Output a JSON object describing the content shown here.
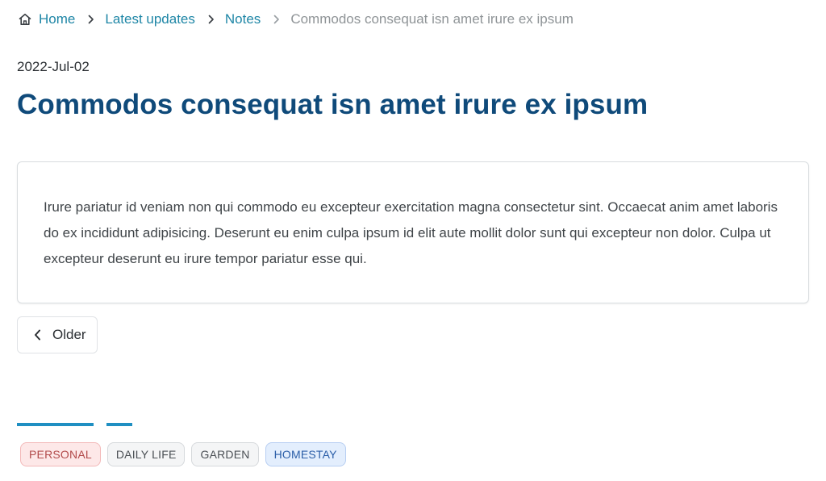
{
  "breadcrumb": {
    "home_label": "Home",
    "items": [
      "Latest updates",
      "Notes"
    ],
    "current": "Commodos consequat isn amet irure ex ipsum",
    "home_icon": "home-icon",
    "separator_icon": "chevron-right-icon"
  },
  "post": {
    "date": "2022-Jul-02",
    "title": "Commodos consequat isn amet irure ex ipsum",
    "body": "Irure pariatur id veniam non qui commodo eu excepteur exercitation magna consectetur sint. Occaecat anim amet laboris do ex incididunt adipisicing. Deserunt eu enim culpa ipsum id elit aute mollit dolor sunt qui excepteur non dolor. Culpa ut excepteur deserunt eu irure tempor pariatur esse qui."
  },
  "pagination": {
    "older_label": "Older",
    "older_icon": "chevron-left-icon"
  },
  "tags": [
    "PERSONAL",
    "DAILY LIFE",
    "GARDEN",
    "HOMESTAY"
  ],
  "colors": {
    "link": "#1e86a6",
    "title": "#0f4a7a",
    "accent": "#1f8fc2",
    "tag_personal_bg": "#fde8e8",
    "tag_homestay_bg": "#e3eefd"
  }
}
